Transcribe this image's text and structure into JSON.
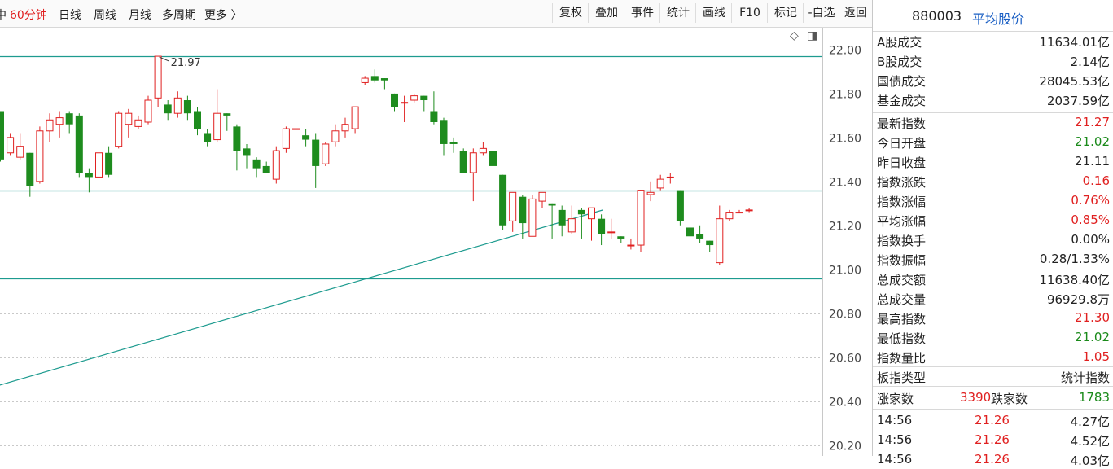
{
  "periods": [
    {
      "label": "中",
      "active": false
    },
    {
      "label": "60分钟",
      "active": true
    },
    {
      "label": "日线",
      "active": false
    },
    {
      "label": "周线",
      "active": false
    },
    {
      "label": "月线",
      "active": false
    },
    {
      "label": "多周期",
      "active": false
    },
    {
      "label": "更多 〉",
      "active": false
    }
  ],
  "tools": [
    "复权",
    "叠加",
    "事件",
    "统计",
    "画线",
    "F10",
    "标记",
    "-自选",
    "返回"
  ],
  "chart_icons": {
    "diamond": "◇",
    "window": "◨"
  },
  "colors": {
    "up": "#e02020",
    "down": "#1e8c1e",
    "line": "#1d9b8f",
    "grid": "#c9c9c9"
  },
  "chart_data": {
    "type": "candlestick",
    "ylim": [
      20.15,
      22.1
    ],
    "y_ticks": [
      "22.00",
      "21.80",
      "21.60",
      "21.40",
      "21.20",
      "21.00",
      "20.80",
      "20.60",
      "20.40",
      "20.20"
    ],
    "max_annotation": "21.97",
    "hlines": [
      21.97,
      21.36,
      20.96
    ],
    "trend_line": {
      "from": [
        -1,
        20.46
      ],
      "to": [
        61.2,
        21.27
      ]
    },
    "candles": [
      [
        21.72,
        21.5,
        21.72,
        21.49
      ],
      [
        21.53,
        21.6,
        21.62,
        21.52
      ],
      [
        21.51,
        21.56,
        21.62,
        21.5
      ],
      [
        21.53,
        21.38,
        21.53,
        21.33
      ],
      [
        21.4,
        21.63,
        21.65,
        21.39
      ],
      [
        21.63,
        21.68,
        21.71,
        21.58
      ],
      [
        21.66,
        21.69,
        21.72,
        21.6
      ],
      [
        21.71,
        21.66,
        21.72,
        21.62
      ],
      [
        21.7,
        21.44,
        21.71,
        21.42
      ],
      [
        21.44,
        21.42,
        21.46,
        21.35
      ],
      [
        21.42,
        21.53,
        21.55,
        21.4
      ],
      [
        21.53,
        21.43,
        21.56,
        21.42
      ],
      [
        21.56,
        21.71,
        21.72,
        21.55
      ],
      [
        21.66,
        21.71,
        21.73,
        21.6
      ],
      [
        21.65,
        21.68,
        21.7,
        21.64
      ],
      [
        21.67,
        21.77,
        21.79,
        21.66
      ],
      [
        21.78,
        21.97,
        21.97,
        21.74
      ],
      [
        21.75,
        21.71,
        21.77,
        21.68
      ],
      [
        21.71,
        21.78,
        21.81,
        21.69
      ],
      [
        21.77,
        21.71,
        21.79,
        21.68
      ],
      [
        21.72,
        21.64,
        21.74,
        21.61
      ],
      [
        21.62,
        21.58,
        21.64,
        21.56
      ],
      [
        21.59,
        21.71,
        21.82,
        21.58
      ],
      [
        21.71,
        21.7,
        21.71,
        21.63
      ],
      [
        21.65,
        21.54,
        21.66,
        21.45
      ],
      [
        21.55,
        21.52,
        21.57,
        21.46
      ],
      [
        21.5,
        21.46,
        21.51,
        21.42
      ],
      [
        21.47,
        21.44,
        21.49,
        21.44
      ],
      [
        21.41,
        21.54,
        21.56,
        21.39
      ],
      [
        21.55,
        21.64,
        21.65,
        21.53
      ],
      [
        21.64,
        21.64,
        21.69,
        21.61
      ],
      [
        21.61,
        21.59,
        21.64,
        21.56
      ],
      [
        21.59,
        21.47,
        21.62,
        21.37
      ],
      [
        21.48,
        21.57,
        21.58,
        21.47
      ],
      [
        21.58,
        21.63,
        21.66,
        21.56
      ],
      [
        21.63,
        21.66,
        21.69,
        21.6
      ],
      [
        21.64,
        21.74,
        21.74,
        21.62
      ],
      [
        21.85,
        21.87,
        21.88,
        21.84
      ],
      [
        21.88,
        21.86,
        21.91,
        21.85
      ],
      [
        21.87,
        21.86,
        21.87,
        21.82
      ],
      [
        21.8,
        21.74,
        21.8,
        21.72
      ],
      [
        21.76,
        21.76,
        21.79,
        21.67
      ],
      [
        21.77,
        21.79,
        21.8,
        21.76
      ],
      [
        21.79,
        21.77,
        21.79,
        21.72
      ],
      [
        21.72,
        21.67,
        21.81,
        21.66
      ],
      [
        21.68,
        21.57,
        21.69,
        21.52
      ],
      [
        21.58,
        21.57,
        21.6,
        21.53
      ],
      [
        21.54,
        21.44,
        21.55,
        21.44
      ],
      [
        21.44,
        21.53,
        21.55,
        21.31
      ],
      [
        21.53,
        21.55,
        21.58,
        21.52
      ],
      [
        21.54,
        21.47,
        21.54,
        21.4
      ],
      [
        21.43,
        21.2,
        21.43,
        21.18
      ],
      [
        21.22,
        21.35,
        21.35,
        21.17
      ],
      [
        21.33,
        21.21,
        21.34,
        21.14
      ],
      [
        21.15,
        21.32,
        21.34,
        21.15
      ],
      [
        21.31,
        21.35,
        21.35,
        21.28
      ],
      [
        21.3,
        21.29,
        21.3,
        21.14
      ],
      [
        21.27,
        21.2,
        21.29,
        21.15
      ],
      [
        21.17,
        21.23,
        21.29,
        21.16
      ],
      [
        21.27,
        21.25,
        21.28,
        21.14
      ],
      [
        21.23,
        21.28,
        21.28,
        21.13
      ],
      [
        21.23,
        21.16,
        21.25,
        21.11
      ],
      [
        21.17,
        21.17,
        21.23,
        21.14
      ],
      [
        21.15,
        21.14,
        21.15,
        21.12
      ],
      [
        21.11,
        21.11,
        21.14,
        21.09
      ],
      [
        21.11,
        21.36,
        21.36,
        21.08
      ],
      [
        21.34,
        21.35,
        21.4,
        21.31
      ],
      [
        21.37,
        21.41,
        21.43,
        21.36
      ],
      [
        21.42,
        21.42,
        21.44,
        21.39
      ],
      [
        21.36,
        21.22,
        21.36,
        21.2
      ],
      [
        21.19,
        21.15,
        21.2,
        21.14
      ],
      [
        21.16,
        21.14,
        21.2,
        21.12
      ],
      [
        21.13,
        21.11,
        21.13,
        21.08
      ],
      [
        21.03,
        21.23,
        21.29,
        21.02
      ],
      [
        21.23,
        21.26,
        21.27,
        21.22
      ],
      [
        21.26,
        21.26,
        21.27,
        21.26
      ],
      [
        21.27,
        21.27,
        21.28,
        21.26
      ]
    ]
  },
  "panel": {
    "code": "880003",
    "name": "平均股价",
    "rows": [
      {
        "label": "A股成交",
        "value": "11634.01亿",
        "color": ""
      },
      {
        "label": "B股成交",
        "value": "2.14亿",
        "color": ""
      },
      {
        "label": "国债成交",
        "value": "28045.53亿",
        "color": ""
      },
      {
        "label": "基金成交",
        "value": "2037.59亿",
        "color": ""
      },
      {
        "label": "最新指数",
        "value": "21.27",
        "color": "red"
      },
      {
        "label": "今日开盘",
        "value": "21.02",
        "color": "green"
      },
      {
        "label": "昨日收盘",
        "value": "21.11",
        "color": ""
      },
      {
        "label": "指数涨跌",
        "value": "0.16",
        "color": "red"
      },
      {
        "label": "指数涨幅",
        "value": "0.76%",
        "color": "red"
      },
      {
        "label": "平均涨幅",
        "value": "0.85%",
        "color": "red"
      },
      {
        "label": "指数换手",
        "value": "0.00%",
        "color": ""
      },
      {
        "label": "指数振幅",
        "value": "0.28/1.33%",
        "color": ""
      },
      {
        "label": "总成交额",
        "value": "11638.40亿",
        "color": ""
      },
      {
        "label": "总成交量",
        "value": "96929.8万",
        "color": ""
      },
      {
        "label": "最高指数",
        "value": "21.30",
        "color": "red"
      },
      {
        "label": "最低指数",
        "value": "21.02",
        "color": "green"
      },
      {
        "label": "指数量比",
        "value": "1.05",
        "color": "red"
      },
      {
        "label": "板指类型",
        "value": "统计指数",
        "color": ""
      }
    ],
    "breadth": {
      "up_label": "涨家数",
      "up": "3390",
      "down_label": "跌家数",
      "down": "1783"
    },
    "ticks": [
      {
        "time": "14:56",
        "price": "21.26",
        "amount": "4.27亿"
      },
      {
        "time": "14:56",
        "price": "21.26",
        "amount": "4.52亿"
      },
      {
        "time": "14:56",
        "price": "21.26",
        "amount": "4.03亿"
      }
    ]
  }
}
